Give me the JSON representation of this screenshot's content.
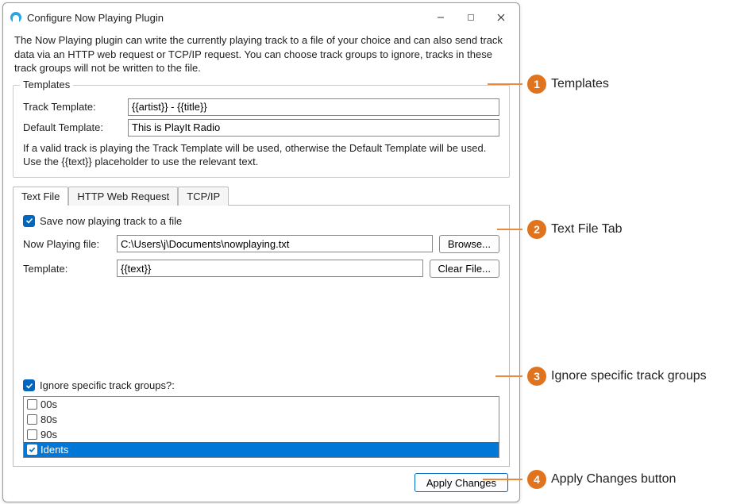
{
  "window": {
    "title": "Configure Now Playing Plugin"
  },
  "intro": "The Now Playing plugin can write the currently playing track to a file of your choice and can also send track data via an HTTP web request or TCP/IP request. You can choose track groups to ignore, tracks in these track groups will not be written to the file.",
  "templates": {
    "legend": "Templates",
    "track_label": "Track Template:",
    "track_value": "{{artist}} - {{title}}",
    "default_label": "Default Template:",
    "default_value": "This is PlayIt Radio",
    "hint": "If a valid track is playing the Track Template will be used, otherwise the Default Template will be used. Use the {{text}} placeholder to use the relevant text."
  },
  "tabs": {
    "text_file": "Text File",
    "http": "HTTP Web Request",
    "tcpip": "TCP/IP"
  },
  "textfile": {
    "save_label": "Save now playing track to a file",
    "file_label": "Now Playing file:",
    "file_value": "C:\\Users\\j\\Documents\\nowplaying.txt",
    "template_label": "Template:",
    "template_value": "{{text}}",
    "browse": "Browse...",
    "clear": "Clear File..."
  },
  "ignore": {
    "question": "Ignore specific track groups?:",
    "items": [
      {
        "label": "00s",
        "checked": false,
        "selected": false
      },
      {
        "label": "80s",
        "checked": false,
        "selected": false
      },
      {
        "label": "90s",
        "checked": false,
        "selected": false
      },
      {
        "label": "Idents",
        "checked": true,
        "selected": true
      }
    ]
  },
  "footer": {
    "apply": "Apply Changes"
  },
  "callouts": {
    "c1": "Templates",
    "c2": "Text File Tab",
    "c3": "Ignore specific track groups",
    "c4": "Apply Changes button"
  }
}
